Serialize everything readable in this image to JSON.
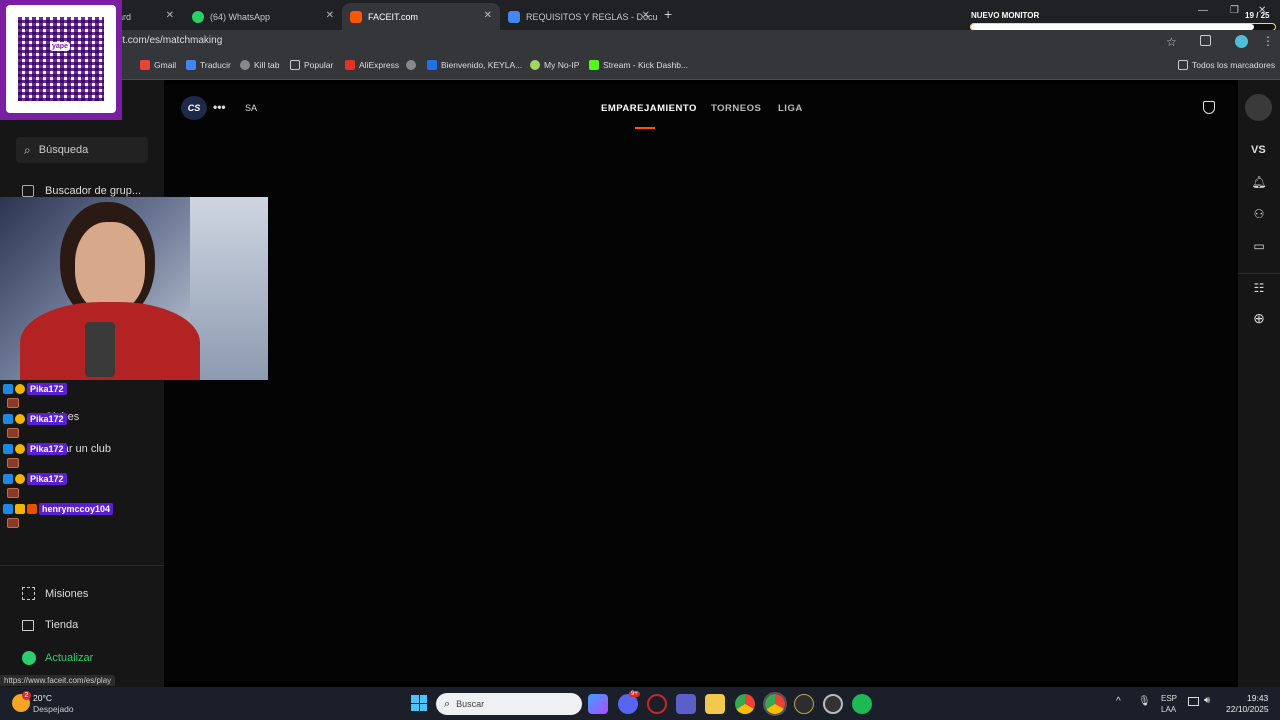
{
  "browser": {
    "tabs": [
      {
        "label": "ard",
        "active": false
      },
      {
        "label": "(64) WhatsApp",
        "active": false
      },
      {
        "label": "FACEIT.com",
        "active": true
      },
      {
        "label": "REQUISITOS Y REGLAS - Docum",
        "active": false
      }
    ],
    "url": "it.com/es/matchmaking",
    "bookmarks": [
      "Gmail",
      "Traducir",
      "Kill tab",
      "Popular",
      "AliExpress",
      "Bienvenido, KEYLA...",
      "My No-IP",
      "Stream - Kick Dashb..."
    ],
    "bookmarks_all": "Todos los marcadores",
    "status_url": "https://www.faceit.com/es/play"
  },
  "overlay": {
    "monitor_label": "NUEVO MONITOR",
    "monitor_count": "19 / 25",
    "monitor_progress": 0.93,
    "qr_caption": "yape"
  },
  "faceit": {
    "game": "CS",
    "region": "SA",
    "nav": [
      "EMPAREJAMIENTO",
      "TORNEOS",
      "LIGA"
    ],
    "search_label": "Búsqueda",
    "group_finder": "Buscador de grup...",
    "clubs": "Clubes",
    "create_club": "Crear un club",
    "missions": "Misiones",
    "store": "Tienda",
    "upgrade": "Actualizar",
    "vs_label": "VS"
  },
  "chat": {
    "messages": [
      {
        "user": "Pika172"
      },
      {
        "user": "Pika172"
      },
      {
        "user": "Pika172"
      },
      {
        "user": "Pika172"
      },
      {
        "user": "henrymccoy104"
      }
    ]
  },
  "taskbar": {
    "weather_temp": "20°C",
    "weather_desc": "Despejado",
    "weather_badge": "2",
    "search_placeholder": "Buscar",
    "discord_badge": "9+",
    "lang_top": "ESP",
    "lang_bottom": "LAA",
    "time": "19:43",
    "date": "22/10/2025"
  },
  "colors": {
    "accent": "#ff5500",
    "upgrade": "#2ecc71",
    "chat_name": "#5a1fd1"
  }
}
